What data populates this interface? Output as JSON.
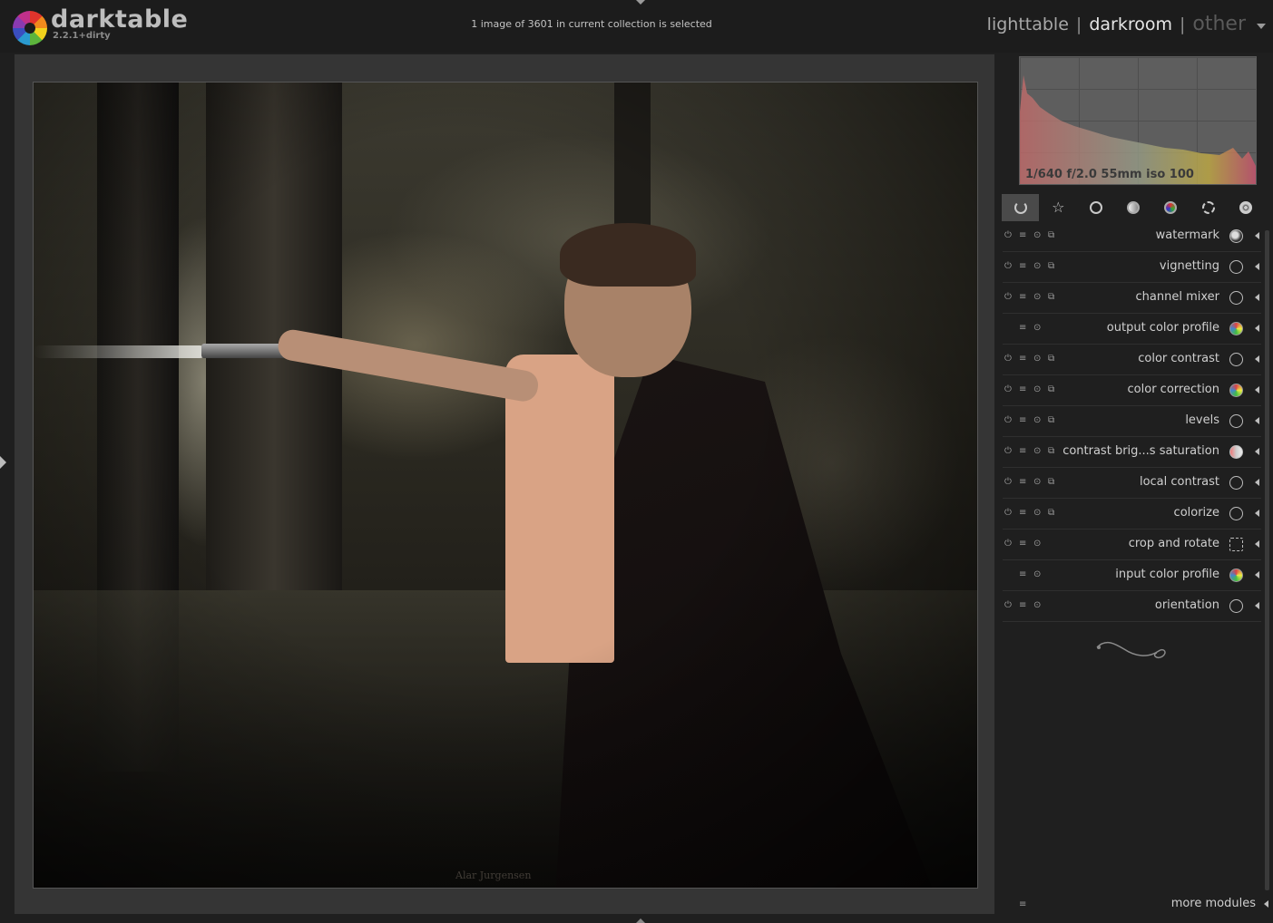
{
  "header": {
    "app_name": "darktable",
    "version": "2.2.1+dirty",
    "status": "1 image of 3601 in current collection is selected",
    "views": {
      "lighttable": "lighttable",
      "darkroom": "darkroom",
      "other": "other",
      "separator": "|"
    }
  },
  "center": {
    "photo_credit": "Alar Jurgensen"
  },
  "histogram": {
    "exif": "1/640 f/2.0 55mm iso 100"
  },
  "module_groups": [
    {
      "name": "active modules",
      "icon": "power-icon",
      "active": true
    },
    {
      "name": "favorite modules",
      "icon": "star-icon"
    },
    {
      "name": "basic group",
      "icon": "circle-icon"
    },
    {
      "name": "tone group",
      "icon": "grey-circle-icon"
    },
    {
      "name": "color group",
      "icon": "color-circle-icon"
    },
    {
      "name": "correction group",
      "icon": "rotate-icon"
    },
    {
      "name": "effect group",
      "icon": "effect-icon"
    }
  ],
  "modules": [
    {
      "name": "watermark",
      "icon": "watermark-icon"
    },
    {
      "name": "vignetting",
      "icon": "vignetting-icon"
    },
    {
      "name": "channel mixer",
      "icon": "channel-mixer-icon"
    },
    {
      "name": "output color profile",
      "icon": "output-color-profile-icon"
    },
    {
      "name": "color contrast",
      "icon": "color-contrast-icon"
    },
    {
      "name": "color correction",
      "icon": "color-correction-icon"
    },
    {
      "name": "levels",
      "icon": "levels-icon"
    },
    {
      "name": "contrast brig...s saturation",
      "icon": "contrast-brightness-saturation-icon"
    },
    {
      "name": "local contrast",
      "icon": "local-contrast-icon"
    },
    {
      "name": "colorize",
      "icon": "colorize-icon"
    },
    {
      "name": "crop and rotate",
      "icon": "crop-rotate-icon"
    },
    {
      "name": "input color profile",
      "icon": "input-color-profile-icon"
    },
    {
      "name": "orientation",
      "icon": "orientation-icon"
    }
  ],
  "footer": {
    "more_modules": "more modules"
  },
  "colors": {
    "background": "#1f1f1f",
    "center_bg": "#353535",
    "text": "#cfcfcf"
  }
}
